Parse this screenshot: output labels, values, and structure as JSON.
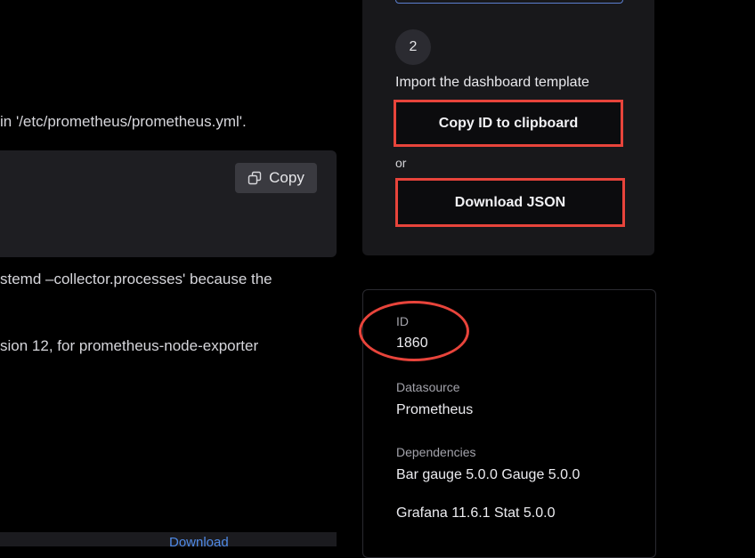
{
  "left": {
    "line1": "in '/etc/prometheus/prometheus.yml'.",
    "code": {
      "copy_label": "Copy"
    },
    "line2": "stemd –collector.processes' because the",
    "line3": "sion 12, for prometheus-node-exporter",
    "bottom_link": "Download"
  },
  "import_card": {
    "step_number": "2",
    "step_title": "Import the dashboard template",
    "copy_id_label": "Copy ID to clipboard",
    "or_label": "or",
    "download_label": "Download JSON"
  },
  "info_card": {
    "id_label": "ID",
    "id_value": "1860",
    "datasource_label": "Datasource",
    "datasource_value": "Prometheus",
    "dependencies_label": "Dependencies",
    "dependencies_line1": "Bar gauge 5.0.0 Gauge 5.0.0",
    "dependencies_line2": "Grafana 11.6.1 Stat 5.0.0"
  },
  "colors": {
    "annotation": "#e8443b",
    "link": "#4f8ae6",
    "card_bg": "#18181b"
  },
  "icons": [
    "copy-icon"
  ]
}
